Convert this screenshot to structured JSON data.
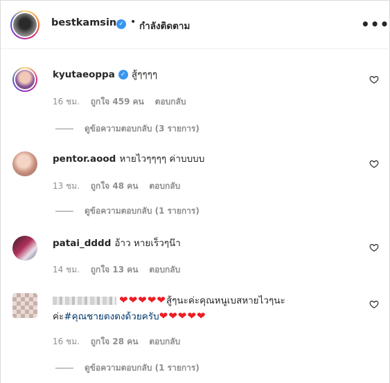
{
  "header": {
    "username": "bestkamsing",
    "separator": "•",
    "follow_status": "กำลังติดตาม",
    "more_label": "•••"
  },
  "comments": [
    {
      "username": "kyutaeoppa",
      "verified": true,
      "text": "สู้ๆๆๆๆ",
      "time": "16 ชม.",
      "likes": "ถูกใจ 459 คน",
      "reply": "ตอบกลับ",
      "view_replies": "ดูข้อความตอบกลับ (3 รายการ)"
    },
    {
      "username": "pentor.aood",
      "verified": false,
      "text": "หายไวๆๆๆๆ ค่าบบบบ",
      "time": "13 ชม.",
      "likes": "ถูกใจ 48 คน",
      "reply": "ตอบกลับ",
      "view_replies": "ดูข้อความตอบกลับ (1 รายการ)"
    },
    {
      "username": "patai_dddd",
      "verified": false,
      "text": "อ้าว หายเร็วๆน๊า",
      "time": "14 ชม.",
      "likes": "ถูกใจ 13 คน",
      "reply": "ตอบกลับ"
    },
    {
      "username": "",
      "verified": false,
      "hearts_a": "❤❤❤❤❤",
      "text_a": "สู้ๆนะค่ะคุณหนูเบสหายไวๆนะ",
      "text_b": "ค่ะ",
      "hashtag": "#คุณชายตงตงด้วยครับ",
      "hearts_b": "❤❤❤❤❤",
      "time": "16 ชม.",
      "likes": "ถูกใจ 28 คน",
      "reply": "ตอบกลับ",
      "view_replies": "ดูข้อความตอบกลับ (1 รายการ)"
    }
  ],
  "colors": {
    "text": "#262626",
    "meta": "#8e8e8e",
    "verified": "#3897f0",
    "heart_emoji": "#ed1c24",
    "hashtag": "#00376b"
  },
  "icons": [
    "verified-badge-icon",
    "more-options-icon",
    "heart-outline-icon"
  ]
}
